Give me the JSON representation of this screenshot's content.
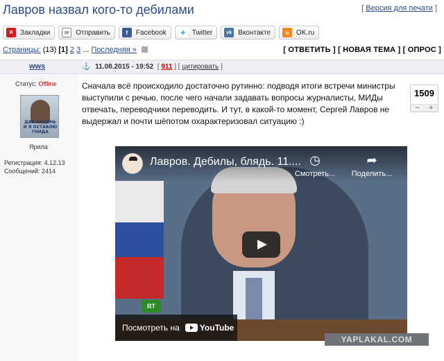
{
  "topic": {
    "title": "Лавров назвал кого-то дебилами",
    "print_open": "[",
    "print_label": "Версия для печати",
    "print_close": "]"
  },
  "share": {
    "bookmarks": "Закладки",
    "send": "Отправить",
    "facebook": "Facebook",
    "twitter": "Twitter",
    "vkontakte": "Вконтакте",
    "ok": "OK.ru"
  },
  "pager": {
    "label": "Страницы:",
    "count": "(13)",
    "current": "[1]",
    "page2": "2",
    "page3": "3",
    "ellipsis": "...",
    "last": "Последняя »"
  },
  "actions": {
    "reply": "ОТВЕТИТЬ",
    "new_topic": "НОВАЯ ТЕМА",
    "poll": "ОПРОС"
  },
  "post": {
    "author": "wws",
    "anchor": "⚓",
    "date": "11.08.2015 - 19:52",
    "number": "911",
    "quote": "цитировать",
    "status_label": "Статус:",
    "status_value": "Offline",
    "rank": "Ярила",
    "avatar_caption": "ДАК НАДЕНЬ И Я ОСТАВЛЮ ГНИДА",
    "registration_label": "Регистрация:",
    "registration_date": "4.12.13",
    "messages_label": "Сообщений:",
    "messages_count": "2414",
    "text": "Сначала всё происходило достаточно рутинно: подводя итоги встречи министры выступили с речью, после чего начали задавать вопросы журналисты, МИДы отвечать, переводчики переводить. И тут, в какой-то момент, Сергей Лавров не выдержал и почти шёпотом охарактеризовал ситуацию :)",
    "rating": "1509",
    "rating_minus": "−",
    "rating_plus": "+"
  },
  "video": {
    "title": "Лавров. Дебилы, блядь. 11....",
    "watch_later": "Смотреть...",
    "share": "Поделить...",
    "channel_logo": "RT",
    "watch_on": "Посмотреть на",
    "youtube": "YouTube"
  },
  "watermark": "YAPLAKAL.COM"
}
